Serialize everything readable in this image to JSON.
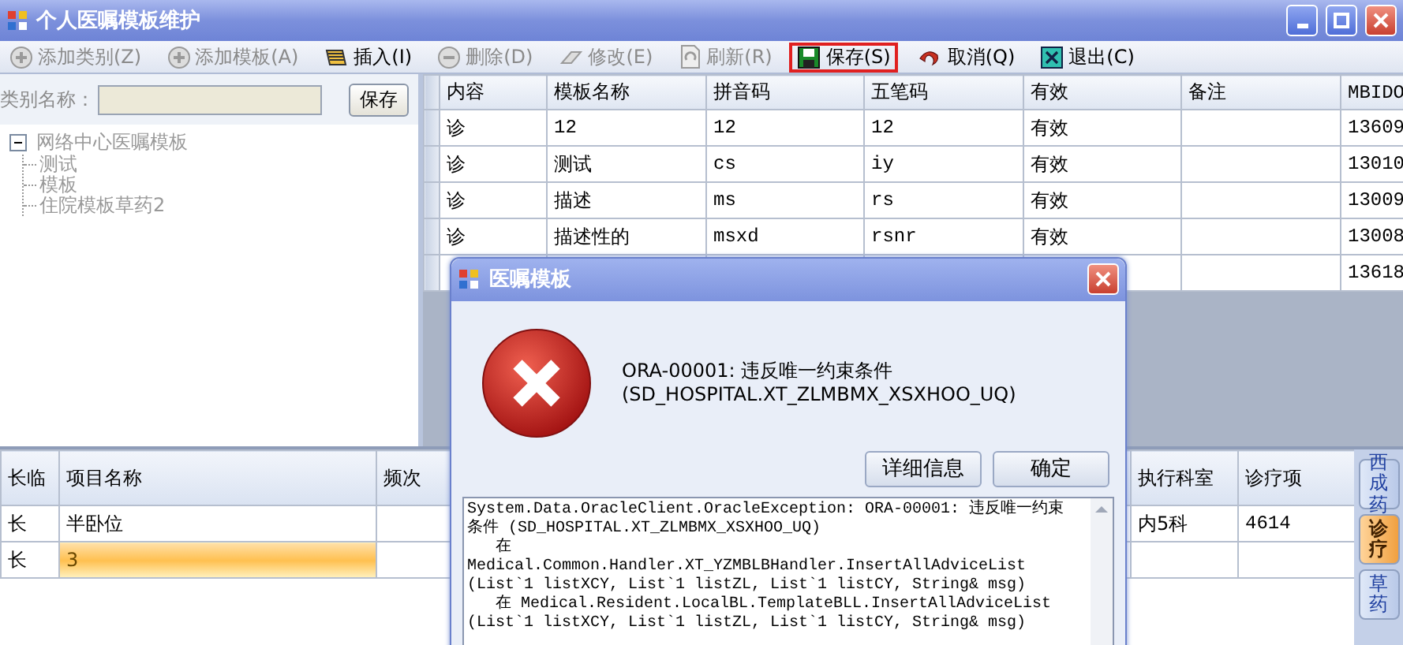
{
  "window": {
    "title": "个人医嘱模板维护"
  },
  "toolbar": [
    {
      "kind": "add",
      "label": "添加类别(Z)",
      "disabled": true,
      "highlighted": false
    },
    {
      "kind": "add",
      "label": "添加模板(A)",
      "disabled": true,
      "highlighted": false
    },
    {
      "kind": "insert",
      "label": "插入(I)",
      "disabled": false,
      "highlighted": false
    },
    {
      "kind": "delete",
      "label": "删除(D)",
      "disabled": true,
      "highlighted": false
    },
    {
      "kind": "edit",
      "label": "修改(E)",
      "disabled": true,
      "highlighted": false
    },
    {
      "kind": "refresh",
      "label": "刷新(R)",
      "disabled": true,
      "highlighted": false
    },
    {
      "kind": "save",
      "label": "保存(S)",
      "disabled": false,
      "highlighted": true
    },
    {
      "kind": "cancel",
      "label": "取消(Q)",
      "disabled": false,
      "highlighted": false
    },
    {
      "kind": "exit",
      "label": "退出(C)",
      "disabled": false,
      "highlighted": false
    }
  ],
  "category": {
    "label": "类别名称：",
    "disabled": true,
    "button": "保存"
  },
  "tree": [
    {
      "label": "网络中心医嘱模板",
      "expanded": true,
      "children": [
        {
          "label": "测试"
        },
        {
          "label": "模板"
        },
        {
          "label": "住院模板草药2"
        }
      ]
    }
  ],
  "template_table": {
    "columns": [
      "内容",
      "模板名称",
      "拼音码",
      "五笔码",
      "有效",
      "备注",
      "MBIDO"
    ],
    "rows": [
      {
        "content": "诊",
        "name": "12",
        "pinyin": "12",
        "wubi": "12",
        "valid": "有效",
        "mbid": "13609"
      },
      {
        "content": "诊",
        "name": "测试",
        "pinyin": "cs",
        "wubi": "iy",
        "valid": "有效",
        "mbid": "13010"
      },
      {
        "content": "诊",
        "name": "描述",
        "pinyin": "ms",
        "wubi": "rs",
        "valid": "有效",
        "mbid": "13009"
      },
      {
        "content": "诊",
        "name": "描述性的",
        "pinyin": "msxd",
        "wubi": "rsnr",
        "valid": "有效",
        "mbid": "13008"
      },
      {
        "mbid": "13618"
      }
    ]
  },
  "item_table": {
    "columns": [
      "长临",
      "项目名称",
      "频次",
      "执行科室",
      "诊疗项"
    ],
    "rows": [
      {
        "type": "长",
        "item": "半卧位",
        "dept": "内5科",
        "code": "4614",
        "selected": false
      },
      {
        "type": "长",
        "item": "3",
        "selected": true
      }
    ]
  },
  "side_tabs": [
    {
      "label": "西成药",
      "selected": false
    },
    {
      "label": "诊疗",
      "selected": true
    },
    {
      "label": "草药",
      "selected": false
    }
  ],
  "dialog": {
    "title": "医嘱模板",
    "message": [
      "ORA-00001: 违反唯一约束条件",
      "(SD_HOSPITAL.XT_ZLMBMX_XSXHOO_UQ)"
    ],
    "buttons": [
      "详细信息",
      "确定"
    ],
    "details": [
      "System.Data.OracleClient.OracleException: ORA-00001: 违反唯一约束",
      "条件 (SD_HOSPITAL.XT_ZLMBMX_XSXHOO_UQ)",
      "   在",
      "Medical.Common.Handler.XT_YZMBLBHandler.InsertAllAdviceList",
      "(List`1 listXCY, List`1 listZL, List`1 listCY, String& msg)",
      "   在 Medical.Resident.LocalBL.TemplateBLL.InsertAllAdviceList",
      "(List`1 listXCY, List`1 listZL, List`1 listCY, String& msg)"
    ]
  }
}
